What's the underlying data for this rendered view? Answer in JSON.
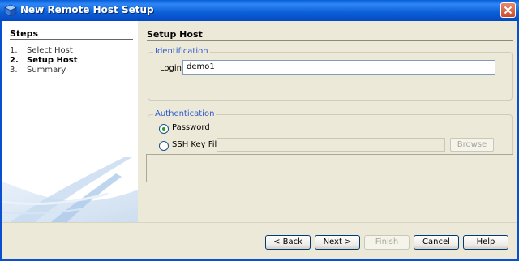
{
  "window": {
    "title": "New Remote Host Setup",
    "title_icon": "cube-icon",
    "accent": "#0a5fd8"
  },
  "steps": {
    "heading": "Steps",
    "items": [
      {
        "num": "1.",
        "label": "Select Host",
        "current": false
      },
      {
        "num": "2.",
        "label": "Setup Host",
        "current": true
      },
      {
        "num": "3.",
        "label": "Summary",
        "current": false
      }
    ]
  },
  "main": {
    "section_title": "Setup Host",
    "identification": {
      "legend": "Identification",
      "login_label": "Login:",
      "login_value": "demo1"
    },
    "authentication": {
      "legend": "Authentication",
      "password_label": "Password",
      "password_selected": true,
      "sshkey_label": "SSH Key File",
      "sshkey_selected": false,
      "sshkey_value": "",
      "browse_label": "Browse"
    },
    "message": ""
  },
  "buttons": {
    "back": "< Back",
    "next": "Next >",
    "finish": "Finish",
    "cancel": "Cancel",
    "help": "Help"
  }
}
